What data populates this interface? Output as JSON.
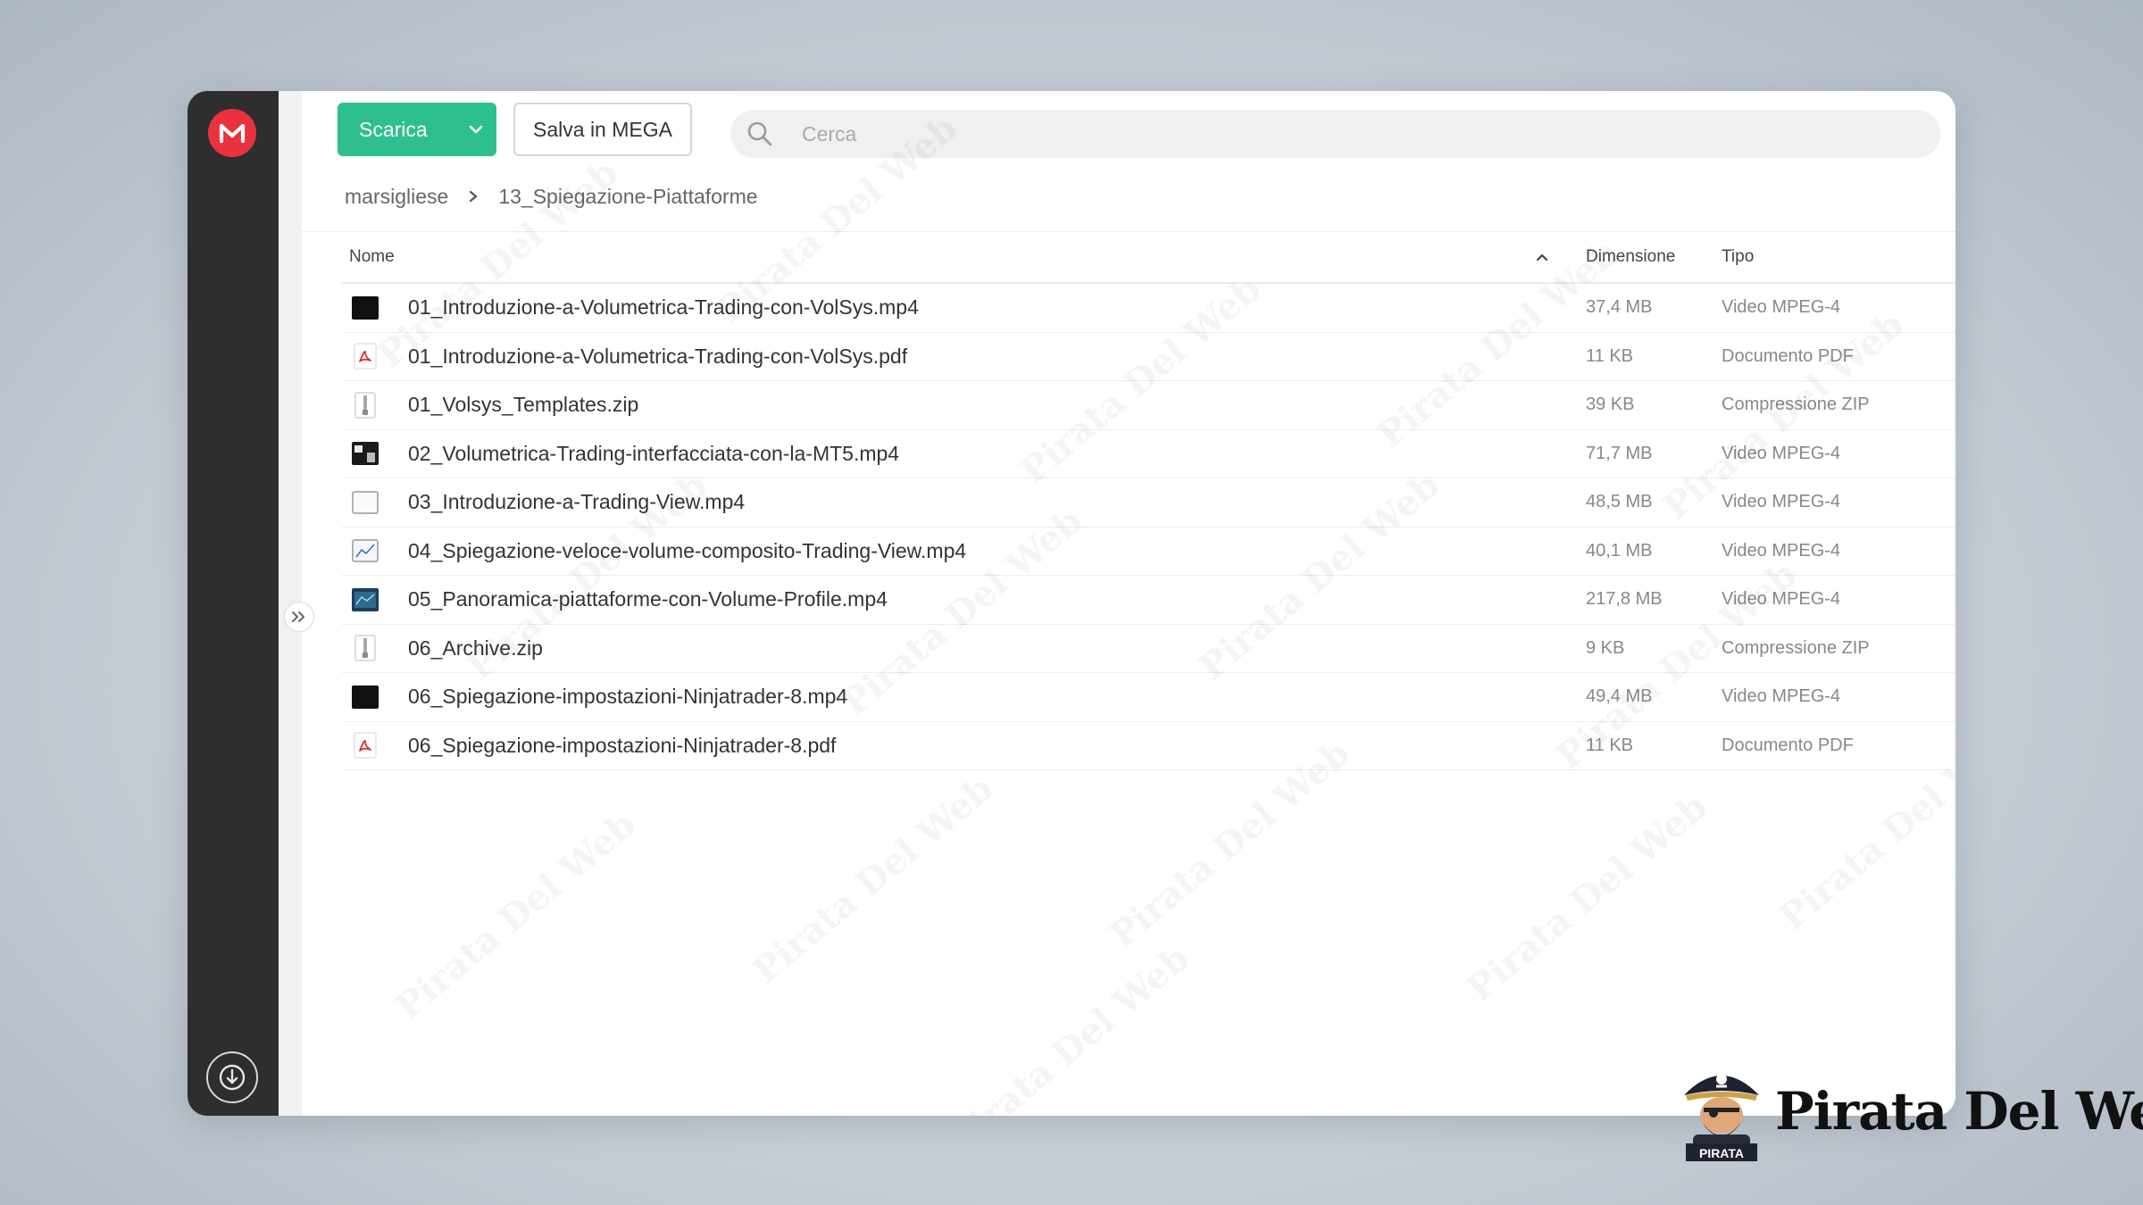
{
  "toolbar": {
    "download_label": "Scarica",
    "save_label": "Salva in MEGA",
    "search_placeholder": "Cerca"
  },
  "breadcrumb": [
    "marsigliese",
    "13_Spiegazione-Piattaforme"
  ],
  "table": {
    "columns": {
      "name": "Nome",
      "size": "Dimensione",
      "type": "Tipo"
    },
    "sort": {
      "column": "name",
      "direction": "ascending"
    },
    "rows": [
      {
        "name": "01_Introduzione-a-Volumetrica-Trading-con-VolSys.mp4",
        "size": "37,4 MB",
        "type": "Video MPEG-4",
        "icon": "video-thumbnail-dark-icon"
      },
      {
        "name": "01_Introduzione-a-Volumetrica-Trading-con-VolSys.pdf",
        "size": "11 KB",
        "type": "Documento PDF",
        "icon": "pdf-icon"
      },
      {
        "name": "01_Volsys_Templates.zip",
        "size": "39 KB",
        "type": "Compressione ZIP",
        "icon": "zip-icon"
      },
      {
        "name": "02_Volumetrica-Trading-interfacciata-con-la-MT5.mp4",
        "size": "71,7 MB",
        "type": "Video MPEG-4",
        "icon": "video-thumbnail-chart-icon"
      },
      {
        "name": "03_Introduzione-a-Trading-View.mp4",
        "size": "48,5 MB",
        "type": "Video MPEG-4",
        "icon": "video-thumbnail-light-icon"
      },
      {
        "name": "04_Spiegazione-veloce-volume-composito-Trading-View.mp4",
        "size": "40,1 MB",
        "type": "Video MPEG-4",
        "icon": "video-thumbnail-light-chart-icon"
      },
      {
        "name": "05_Panoramica-piattaforme-con-Volume-Profile.mp4",
        "size": "217,8 MB",
        "type": "Video MPEG-4",
        "icon": "video-thumbnail-blue-icon"
      },
      {
        "name": "06_Archive.zip",
        "size": "9 KB",
        "type": "Compressione ZIP",
        "icon": "zip-icon"
      },
      {
        "name": "06_Spiegazione-impostazioni-Ninjatrader-8.mp4",
        "size": "49,4 MB",
        "type": "Video MPEG-4",
        "icon": "video-thumbnail-dark-icon"
      },
      {
        "name": "06_Spiegazione-impostazioni-Ninjatrader-8.pdf",
        "size": "11 KB",
        "type": "Documento PDF",
        "icon": "pdf-icon"
      }
    ]
  },
  "watermark": {
    "text": "Pirata Del Web"
  },
  "brand": {
    "text": "Pirata Del Web",
    "badge": "PIRATA"
  },
  "colors": {
    "accent": "#2ebf91",
    "mega_red": "#e9323d",
    "sidebar": "#2e2e2e"
  }
}
